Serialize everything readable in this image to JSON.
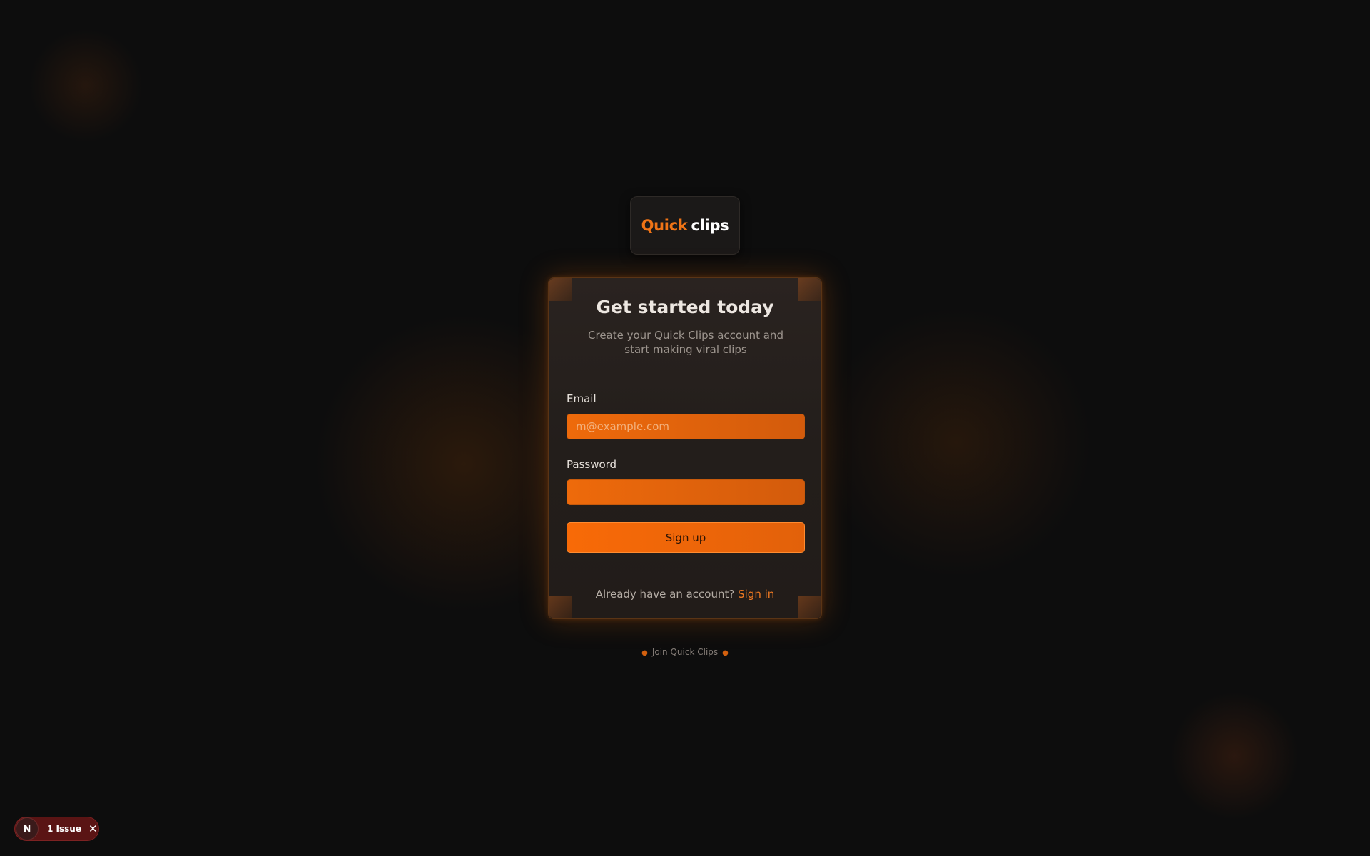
{
  "brand": {
    "logo_part1": "Quick",
    "logo_part2": "clips",
    "accent": "#f07416"
  },
  "card": {
    "title": "Get started today",
    "subtitle": "Create your Quick Clips account and start making viral clips",
    "email_label": "Email",
    "email_placeholder": "m@example.com",
    "email_value": "",
    "password_label": "Password",
    "password_value": "",
    "submit_label": "Sign up",
    "signin_prompt": "Already have an account?",
    "signin_link": "Sign in"
  },
  "footer": {
    "tagline": "Join Quick Clips"
  },
  "issues_badge": {
    "avatar_letter": "N",
    "label": "1 Issue",
    "close_icon": "close-icon"
  }
}
